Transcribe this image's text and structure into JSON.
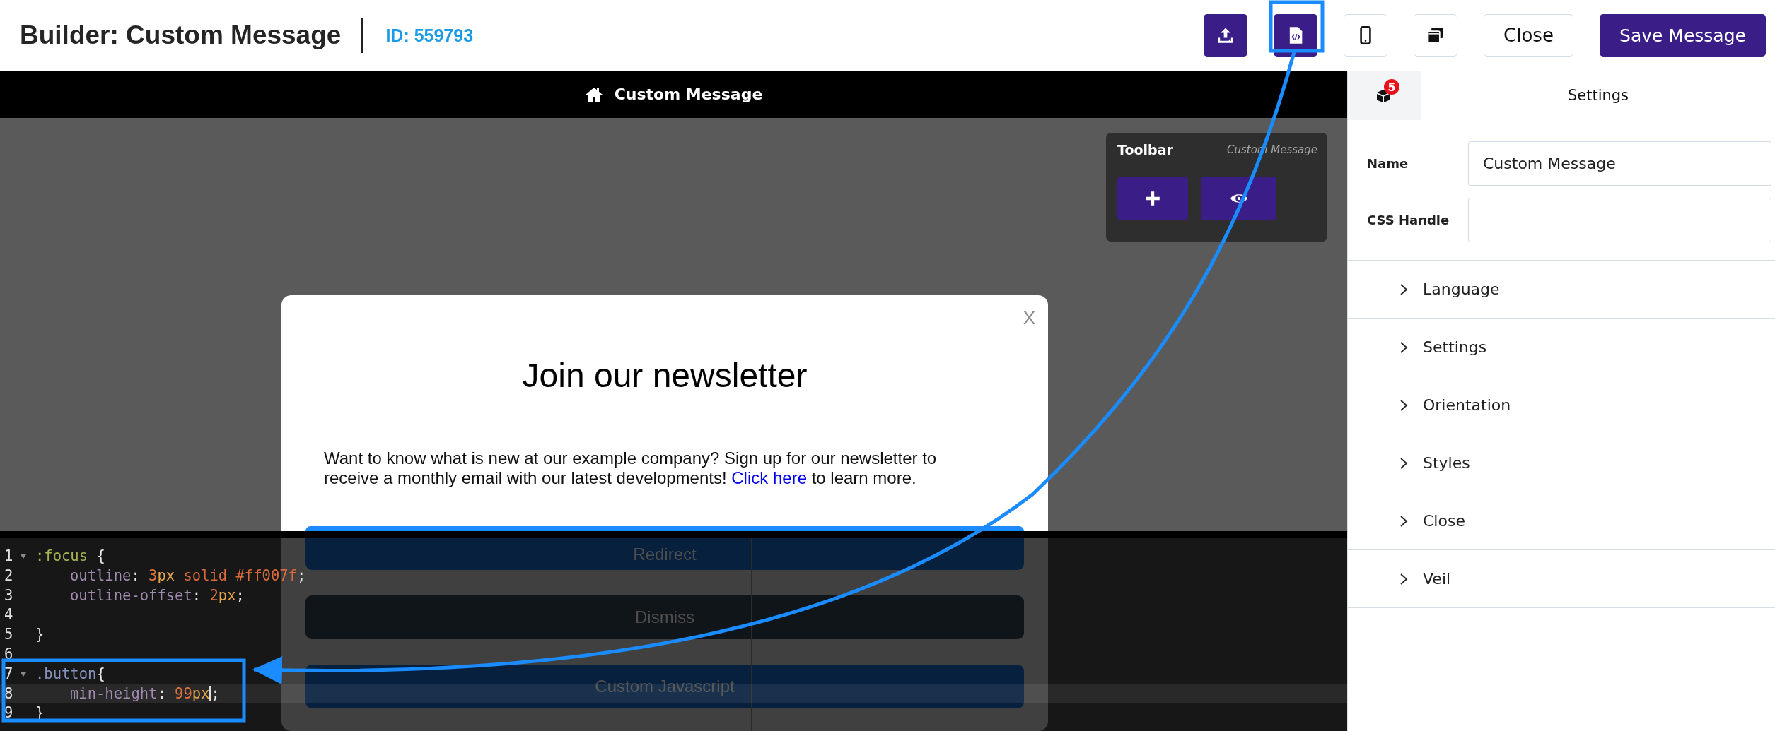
{
  "header": {
    "title": "Builder: Custom Message",
    "id_label": "ID: 559793",
    "actions": [
      {
        "kind": "upload"
      },
      {
        "kind": "code"
      },
      {
        "kind": "mobile"
      },
      {
        "kind": "copy"
      }
    ],
    "buttons": [
      {
        "label": "Close",
        "kind": "secondary"
      },
      {
        "label": "Save Message",
        "kind": "primary"
      }
    ]
  },
  "preview_bar": {
    "title": "Custom Message"
  },
  "toolbar": {
    "title": "Toolbar",
    "subtitle": "Custom Message",
    "buttons": [
      {
        "kind": "add"
      },
      {
        "kind": "preview"
      }
    ]
  },
  "message": {
    "close": "X",
    "title": "Join our newsletter",
    "body": "Want to know what is new at our example company? Sign up for our newsletter to receive a monthly email with our latest developments! ",
    "link": "Click here",
    "body_end": " to learn more.",
    "buttons": [
      {
        "label": "Redirect",
        "kind": "primary"
      },
      {
        "label": "Dismiss",
        "kind": "secondary"
      },
      {
        "label": "Custom Javascript",
        "kind": "primary"
      }
    ]
  },
  "editor": {
    "lines": [
      {
        "number": "1",
        "foldable": true,
        "indented": false,
        "active": false,
        "tokens": [
          {
            "text": ":focus",
            "kind": "pseudo"
          },
          {
            "text": " {",
            "kind": "plain"
          }
        ]
      },
      {
        "number": "2",
        "foldable": false,
        "indented": true,
        "active": false,
        "tokens": [
          {
            "text": "outline",
            "kind": "property"
          },
          {
            "text": ": ",
            "kind": "plain"
          },
          {
            "text": "3",
            "kind": "number"
          },
          {
            "text": "px",
            "kind": "unit"
          },
          {
            "text": " solid #ff007f",
            "kind": "keyword"
          },
          {
            "text": ";",
            "kind": "plain"
          }
        ]
      },
      {
        "number": "3",
        "foldable": false,
        "indented": true,
        "active": false,
        "tokens": [
          {
            "text": "outline-offset",
            "kind": "property"
          },
          {
            "text": ": ",
            "kind": "plain"
          },
          {
            "text": "2",
            "kind": "number"
          },
          {
            "text": "px",
            "kind": "unit"
          },
          {
            "text": ";",
            "kind": "plain"
          }
        ]
      },
      {
        "number": "4",
        "foldable": false,
        "active": false
      },
      {
        "number": "5",
        "foldable": false,
        "indented": false,
        "active": false,
        "tokens": [
          {
            "text": "}",
            "kind": "plain"
          }
        ]
      },
      {
        "number": "6",
        "foldable": false,
        "active": false
      },
      {
        "number": "7",
        "foldable": true,
        "indented": false,
        "active": false,
        "tokens": [
          {
            "text": ".button",
            "kind": "class"
          },
          {
            "text": "{",
            "kind": "plain"
          }
        ]
      },
      {
        "number": "8",
        "foldable": false,
        "indented": true,
        "active": true,
        "tokens": [
          {
            "text": "min-height",
            "kind": "property"
          },
          {
            "text": ": ",
            "kind": "plain"
          },
          {
            "text": "99",
            "kind": "number"
          },
          {
            "text": "px",
            "kind": "unit"
          },
          {
            "kind": "cursor"
          },
          {
            "text": ";",
            "kind": "plain"
          }
        ]
      },
      {
        "number": "9",
        "foldable": false,
        "indented": false,
        "active": false,
        "tokens": [
          {
            "text": "}",
            "kind": "plain"
          }
        ]
      }
    ]
  },
  "panel": {
    "tabs": [
      {
        "kind": "icon",
        "badge": "5",
        "selected": false
      },
      {
        "kind": "text",
        "label": "Settings",
        "selected": true
      }
    ],
    "fields": [
      {
        "label": "Name",
        "value": "Custom Message"
      },
      {
        "label": "CSS Handle"
      }
    ],
    "sections": [
      {
        "label": "Language",
        "expanded": false
      },
      {
        "label": "Settings",
        "expanded": false
      },
      {
        "label": "Orientation",
        "expanded": false
      },
      {
        "label": "Styles",
        "expanded": false
      },
      {
        "label": "Close",
        "expanded": false
      },
      {
        "label": "Veil",
        "expanded": false
      }
    ]
  }
}
